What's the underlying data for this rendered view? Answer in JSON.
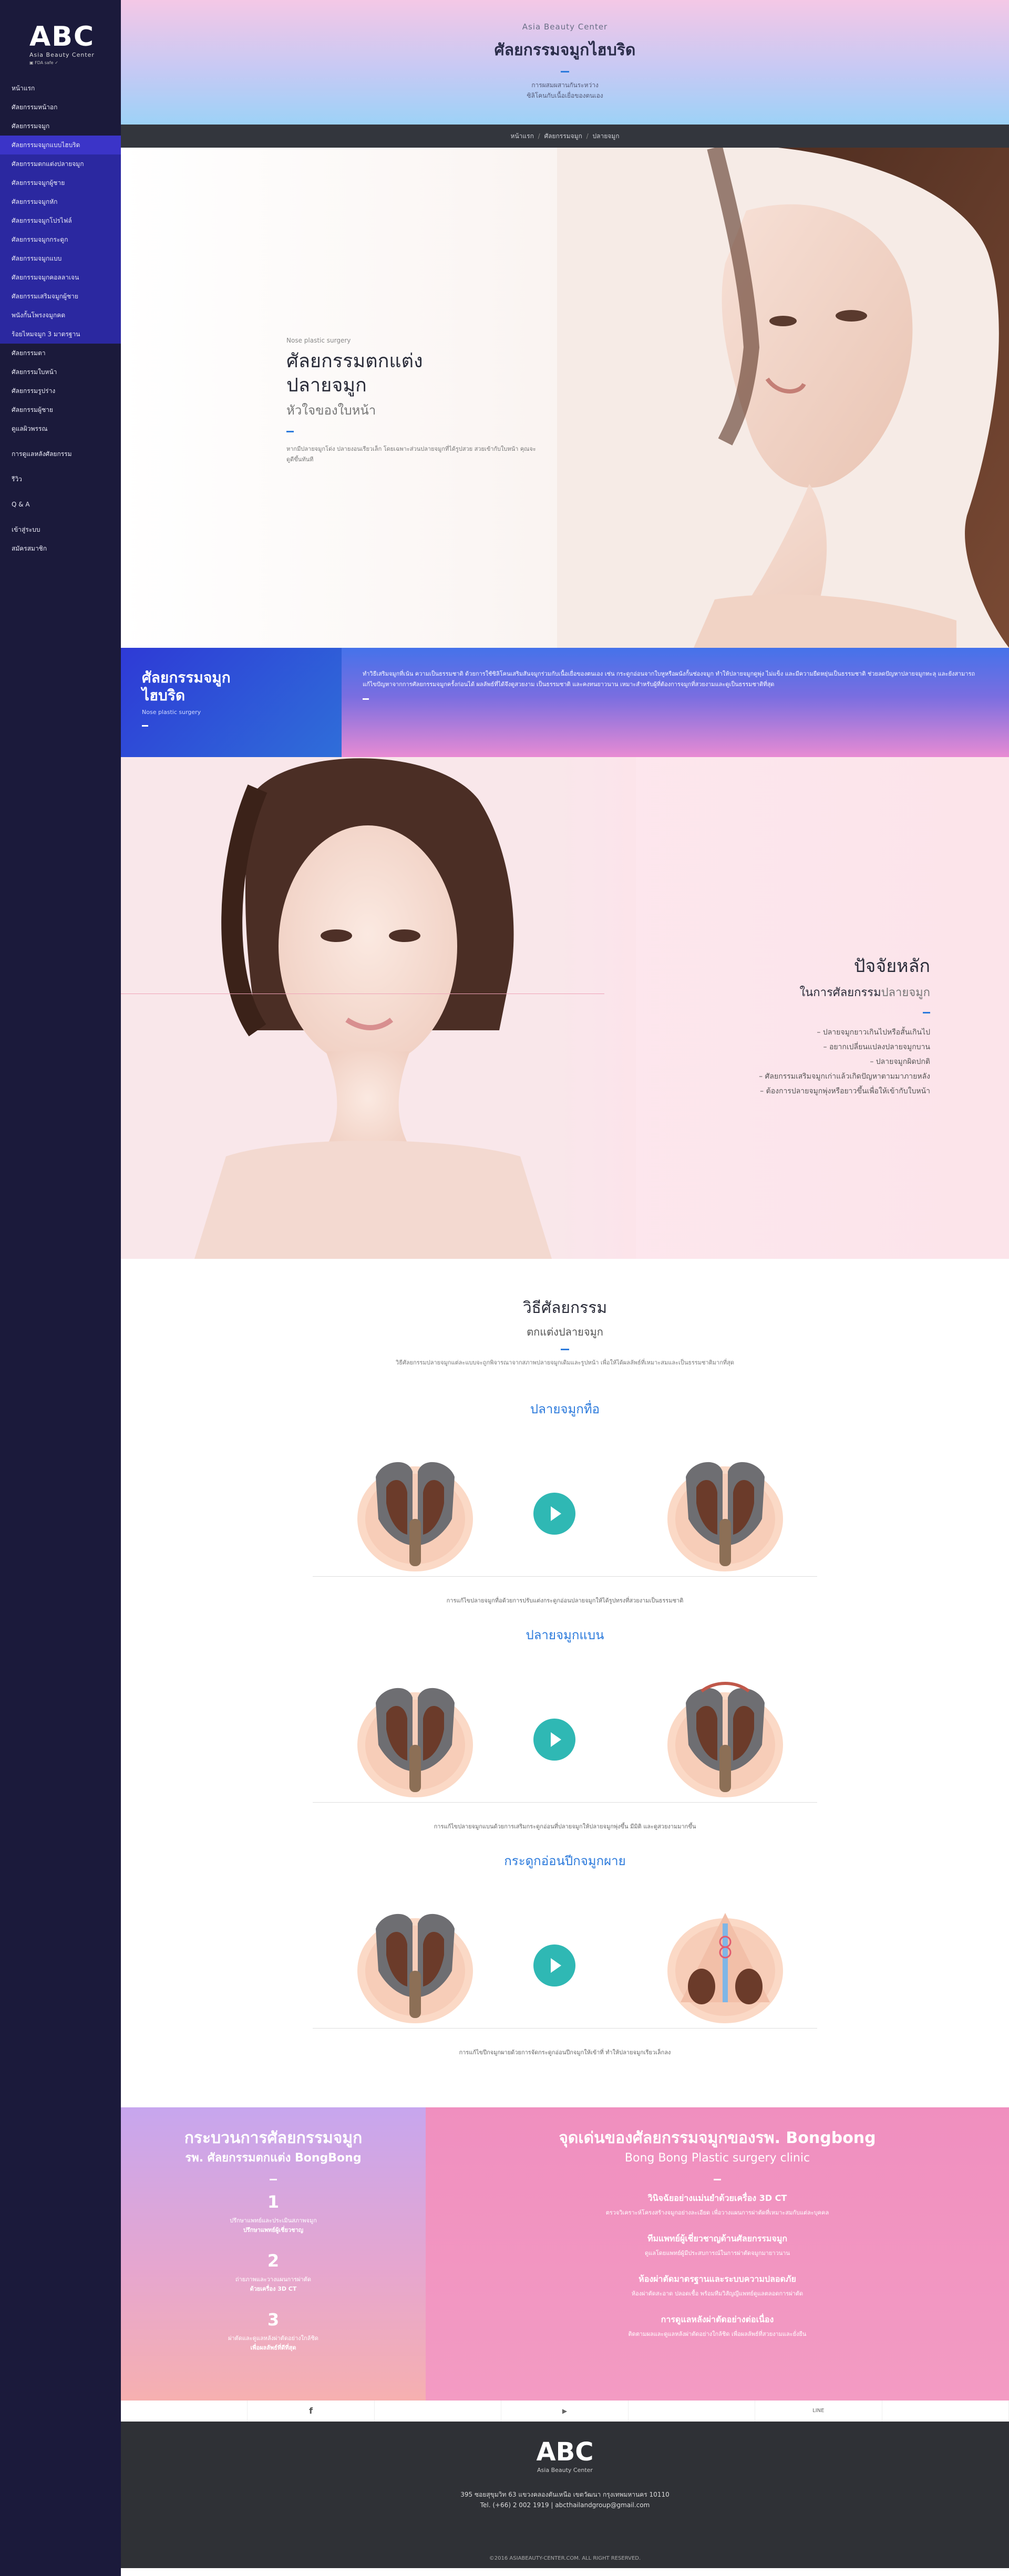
{
  "sidebar": {
    "logo": {
      "text": "ABC",
      "sub": "Asia Beauty Center",
      "badges": "▣  FDA safe ✓"
    },
    "items": [
      {
        "label": "หน้าแรก",
        "type": "top"
      },
      {
        "label": "ศัลยกรรมหน้าอก",
        "type": "top"
      },
      {
        "label": "ศัลยกรรมจมูก",
        "type": "top"
      },
      {
        "label": "ศัลยกรรมจมูกแบบไฮบริด",
        "type": "active"
      },
      {
        "label": "ศัลยกรรมตกแต่งปลายจมูก",
        "type": "sub"
      },
      {
        "label": "ศัลยกรรมจมูกผู้ชาย",
        "type": "sub"
      },
      {
        "label": "ศัลยกรรมจมูกหัก",
        "type": "sub"
      },
      {
        "label": "ศัลยกรรมจมูกโปรไฟล์",
        "type": "sub"
      },
      {
        "label": "ศัลยกรรมจมูกกระดูก",
        "type": "sub"
      },
      {
        "label": "ศัลยกรรมจมูกแบบ",
        "type": "sub"
      },
      {
        "label": "ศัลยกรรมจมูกคอลลาเจน",
        "type": "sub"
      },
      {
        "label": "ศัลยกรรมเสริมจมูกผู้ชาย",
        "type": "sub"
      },
      {
        "label": "พนังกั้นโพรงจมูกคด",
        "type": "sub"
      },
      {
        "label": "ร้อยไหมจมูก 3 มาตรฐาน",
        "type": "sub"
      },
      {
        "label": "ศัลยกรรมตา",
        "type": "top"
      },
      {
        "label": "ศัลยกรรมใบหน้า",
        "type": "top"
      },
      {
        "label": "ศัลยกรรมรูปร่าง",
        "type": "top"
      },
      {
        "label": "ศัลยกรรมผู้ชาย",
        "type": "top"
      },
      {
        "label": "ดูแลผิวพรรณ",
        "type": "top"
      },
      {
        "label": "gap",
        "type": "gap"
      },
      {
        "label": "การดูแลหลังศัลยกรรม",
        "type": "top"
      },
      {
        "label": "gap",
        "type": "gap"
      },
      {
        "label": "รีวิว",
        "type": "top"
      },
      {
        "label": "gap",
        "type": "gap"
      },
      {
        "label": "Q & A",
        "type": "top"
      },
      {
        "label": "gap",
        "type": "gap"
      },
      {
        "label": "เข้าสู่ระบบ",
        "type": "top"
      },
      {
        "label": "สมัครสมาชิก",
        "type": "top"
      }
    ]
  },
  "header": {
    "brand": "Asia Beauty Center",
    "title": "ศัลยกรรมจมูกไฮบริด",
    "desc_1": "การผสมผสานกันระหว่าง",
    "desc_2": "ซิลิโคนกับเนื้อเยื่อของตนเอง"
  },
  "breadcrumb": {
    "home": "หน้าแรก",
    "section": "ศัลยกรรมจมูก",
    "current": "ปลายจมูก"
  },
  "hero1": {
    "eyebrow": "Nose plastic surgery",
    "title_1": "ศัลยกรรมตกแต่ง",
    "title_2": "ปลายจมูก",
    "subtitle": "หัวใจของใบหน้า",
    "body": "หากมีปลายจมูกโด่ง ปลายงอนเรียวเล็ก โดยเฉพาะส่วนปลายจมูกที่ได้รูปสวย สวยเข้ากับใบหน้า คุณจะดูดีขึ้นทันที"
  },
  "intro": {
    "title_1": "ศัลยกรรมจมูก",
    "title_2": "ไฮบริด",
    "en": "Nose plastic surgery",
    "body": "ทำวิธีเสริมจมูกที่เน้น ความเป็นธรรมชาติ ด้วยการใช้ซิลิโคนเสริมสันจมูกร่วมกับเนื้อเยื่อของตนเอง เช่น กระดูกอ่อนจากใบหูหรือผนังกั้นช่องจมูก ทำให้ปลายจมูกดูพุ่ง ไม่แข็ง และมีความยืดหยุ่นเป็นธรรมชาติ ช่วยลดปัญหาปลายจมูกทะลุ และยังสามารถแก้ไขปัญหาจากการศัลยกรรมจมูกครั้งก่อนได้ ผลลัพธ์ที่ได้จึงดูสวยงาม เป็นธรรมชาติ และคงทนยาวนาน เหมาะสำหรับผู้ที่ต้องการจมูกที่สวยงามและดูเป็นธรรมชาติที่สุด"
  },
  "hero2": {
    "title": "ปัจจัยหลัก",
    "subtitle_a": "ในการศัลยกรรม",
    "subtitle_b": "ปลายจมูก",
    "items": [
      "ปลายจมูกยาวเกินไปหรือสั้นเกินไป",
      "อยากเปลี่ยนแปลงปลายจมูกบาน",
      "ปลายจมูกผิดปกติ",
      "ศัลยกรรมเสริมจมูกเก่าแล้วเกิดปัญหาตามมาภายหลัง",
      "ต้องการปลายจมูกพุ่งหรือยาวขึ้นเพื่อให้เข้ากับใบหน้า"
    ]
  },
  "methods": {
    "title": "วิธีศัลยกรรม",
    "subtitle": "ตกแต่งปลายจมูก",
    "intro": "วิธีศัลยกรรมปลายจมูกแต่ละแบบจะถูกพิจารณาจากสภาพปลายจมูกเดิมและรูปหน้า เพื่อให้ได้ผลลัพธ์ที่เหมาะสมและเป็นธรรมชาติมากที่สุด",
    "items": [
      {
        "title": "ปลายจมูกทื่อ",
        "caption": "การแก้ไขปลายจมูกทื่อด้วยการปรับแต่งกระดูกอ่อนปลายจมูกให้ได้รูปทรงที่สวยงามเป็นธรรมชาติ"
      },
      {
        "title": "ปลายจมูกแบน",
        "caption": "การแก้ไขปลายจมูกแบนด้วยการเสริมกระดูกอ่อนที่ปลายจมูกให้ปลายจมูกพุ่งขึ้น มีมิติ และดูสวยงามมากขึ้น"
      },
      {
        "title": "กระดูกอ่อนปีกจมูกผาย",
        "caption": "การแก้ไขปีกจมูกผายด้วยการจัดกระดูกอ่อนปีกจมูกให้เข้าที่ ทำให้ปลายจมูกเรียวเล็กลง"
      }
    ]
  },
  "process": {
    "title": "กระบวนการศัลยกรรมจมูก",
    "subtitle": "รพ. ศัลยกรรมตกแต่ง BongBong",
    "steps": [
      {
        "num": "1",
        "text_1": "ปรึกษาแพทย์และประเมินสภาพจมูก",
        "text_2": "ปรึกษาแพทย์ผู้เชี่ยวชาญ"
      },
      {
        "num": "2",
        "text_1": "ถ่ายภาพและวางแผนการผ่าตัด",
        "text_2": "ด้วยเครื่อง 3D CT"
      },
      {
        "num": "3",
        "text_1": "ผ่าตัดและดูแลหลังผ่าตัดอย่างใกล้ชิด",
        "text_2": "เพื่อผลลัพธ์ที่ดีที่สุด"
      }
    ]
  },
  "highlights": {
    "title": "จุดเด่นของศัลยกรรมจมูกของรพ. Bongbong",
    "subtitle": "Bong Bong Plastic surgery clinic",
    "items": [
      {
        "t": "วินิจฉัยอย่างแม่นยำด้วยเครื่อง 3D CT",
        "d": "ตรวจวิเคราะห์โครงสร้างจมูกอย่างละเอียด เพื่อวางแผนการผ่าตัดที่เหมาะสมกับแต่ละบุคคล"
      },
      {
        "t": "ทีมแพทย์ผู้เชี่ยวชาญด้านศัลยกรรมจมูก",
        "d": "ดูแลโดยแพทย์ผู้มีประสบการณ์ในการผ่าตัดจมูกมายาวนาน"
      },
      {
        "t": "ห้องผ่าตัดมาตรฐานและระบบความปลอดภัย",
        "d": "ห้องผ่าตัดสะอาด ปลอดเชื้อ พร้อมทีมวิสัญญีแพทย์ดูแลตลอดการผ่าตัด"
      },
      {
        "t": "การดูแลหลังผ่าตัดอย่างต่อเนื่อง",
        "d": "ติดตามผลและดูแลหลังผ่าตัดอย่างใกล้ชิด เพื่อผลลัพธ์ที่สวยงามและยั่งยืน"
      }
    ]
  },
  "social": {
    "facebook": "f",
    "youtube": "▶",
    "line": "LINE"
  },
  "footer": {
    "logo": "ABC",
    "sub": "Asia Beauty Center",
    "addr": "395 ซอยสุขุมวิท 63 แขวงคลองตันเหนือ เขตวัฒนา กรุงเทพมหานคร 10110",
    "contact": "Tel. (+66) 2 002 1919 | abcthailandgroup@gmail.com",
    "copy": "©2016 ASIABEAUTY-CENTER.COM. ALL RIGHT RESERVED."
  }
}
